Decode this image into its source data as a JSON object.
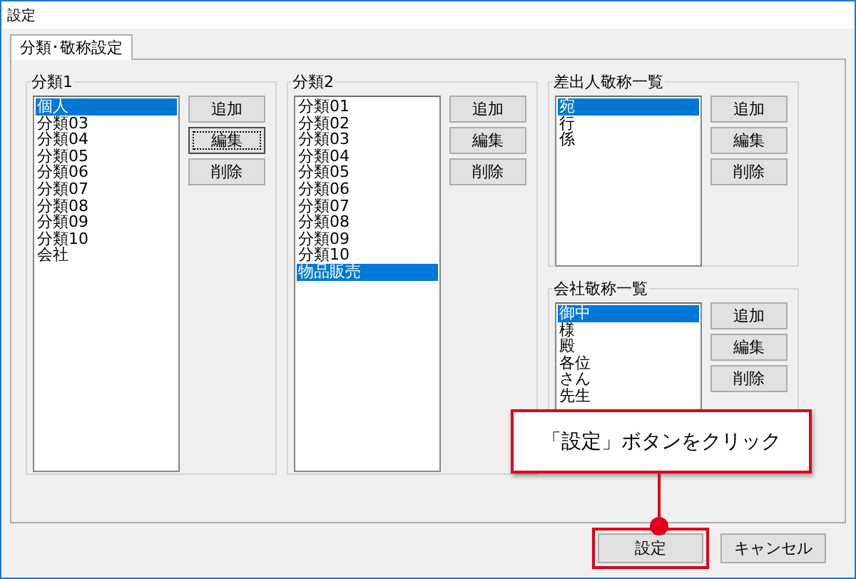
{
  "window": {
    "title": "設定"
  },
  "tabs": [
    {
      "label": "分類･敬称設定",
      "selected": true
    }
  ],
  "columns": [
    {
      "groups": [
        {
          "title": "分類1",
          "items": [
            {
              "label": "個人",
              "selected": true
            },
            {
              "label": "分類03",
              "selected": false
            },
            {
              "label": "分類04",
              "selected": false
            },
            {
              "label": "分類05",
              "selected": false
            },
            {
              "label": "分類06",
              "selected": false
            },
            {
              "label": "分類07",
              "selected": false
            },
            {
              "label": "分類08",
              "selected": false
            },
            {
              "label": "分類09",
              "selected": false
            },
            {
              "label": "分類10",
              "selected": false
            },
            {
              "label": "会社",
              "selected": false
            }
          ],
          "buttons": [
            {
              "label": "追加",
              "focused": false
            },
            {
              "label": "編集",
              "focused": true
            },
            {
              "label": "削除",
              "focused": false
            }
          ]
        }
      ]
    },
    {
      "groups": [
        {
          "title": "分類2",
          "items": [
            {
              "label": "分類01",
              "selected": false
            },
            {
              "label": "分類02",
              "selected": false
            },
            {
              "label": "分類03",
              "selected": false
            },
            {
              "label": "分類04",
              "selected": false
            },
            {
              "label": "分類05",
              "selected": false
            },
            {
              "label": "分類06",
              "selected": false
            },
            {
              "label": "分類07",
              "selected": false
            },
            {
              "label": "分類08",
              "selected": false
            },
            {
              "label": "分類09",
              "selected": false
            },
            {
              "label": "分類10",
              "selected": false
            },
            {
              "label": "物品販売",
              "selected": true
            }
          ],
          "buttons": [
            {
              "label": "追加",
              "focused": false
            },
            {
              "label": "編集",
              "focused": false
            },
            {
              "label": "削除",
              "focused": false
            }
          ]
        }
      ]
    },
    {
      "groups": [
        {
          "title": "差出人敬称一覧",
          "items": [
            {
              "label": "宛",
              "selected": true
            },
            {
              "label": "行",
              "selected": false
            },
            {
              "label": "係",
              "selected": false
            }
          ],
          "buttons": [
            {
              "label": "追加",
              "focused": false
            },
            {
              "label": "編集",
              "focused": false
            },
            {
              "label": "削除",
              "focused": false
            }
          ]
        },
        {
          "title": "会社敬称一覧",
          "items": [
            {
              "label": "御中",
              "selected": true
            },
            {
              "label": "様",
              "selected": false
            },
            {
              "label": "殿",
              "selected": false
            },
            {
              "label": "各位",
              "selected": false
            },
            {
              "label": "さん",
              "selected": false
            },
            {
              "label": "先生",
              "selected": false
            }
          ],
          "buttons": [
            {
              "label": "追加",
              "focused": false
            },
            {
              "label": "編集",
              "focused": false
            },
            {
              "label": "削除",
              "focused": false
            }
          ]
        }
      ]
    }
  ],
  "footer_buttons": [
    {
      "label": "設定",
      "highlighted": true
    },
    {
      "label": "キャンセル",
      "highlighted": false
    }
  ],
  "callout": {
    "text": "「設定」ボタンをクリック"
  }
}
